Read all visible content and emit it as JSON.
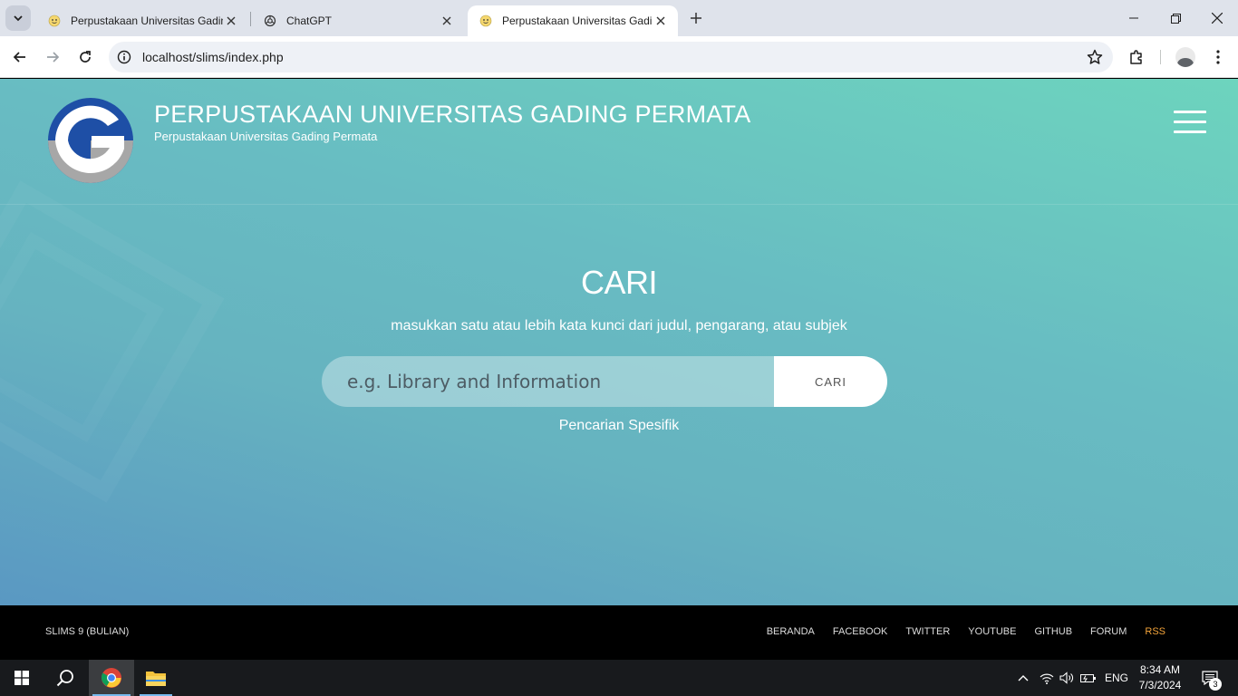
{
  "browser": {
    "tabs": [
      {
        "title": "Perpustakaan Universitas Gadin",
        "active": false,
        "icon": "smiley-favicon-icon"
      },
      {
        "title": "ChatGPT",
        "active": false,
        "icon": "chatgpt-favicon-icon"
      },
      {
        "title": "Perpustakaan Universitas Gadin",
        "active": true,
        "icon": "smiley-favicon-icon"
      }
    ],
    "url": "localhost/slims/index.php"
  },
  "site": {
    "title": "PERPUSTAKAAN UNIVERSITAS GADING PERMATA",
    "subtitle": "Perpustakaan Universitas Gading Permata"
  },
  "search": {
    "heading": "CARI",
    "description": "masukkan satu atau lebih kata kunci dari judul, pengarang, atau subjek",
    "placeholder": "e.g. Library and Information",
    "button_label": "CARI",
    "advanced_link": "Pencarian Spesifik"
  },
  "footer": {
    "version": "SLIMS 9 (BULIAN)",
    "links": [
      "BERANDA",
      "FACEBOOK",
      "TWITTER",
      "YOUTUBE",
      "GITHUB",
      "FORUM",
      "RSS"
    ]
  },
  "taskbar": {
    "language": "ENG",
    "time": "8:34 AM",
    "date": "7/3/2024",
    "notification_count": "3"
  },
  "colors": {
    "accent_rss": "#f2a33a",
    "logo_blue": "#1e4fa6",
    "logo_gray": "#a7a7a7"
  }
}
